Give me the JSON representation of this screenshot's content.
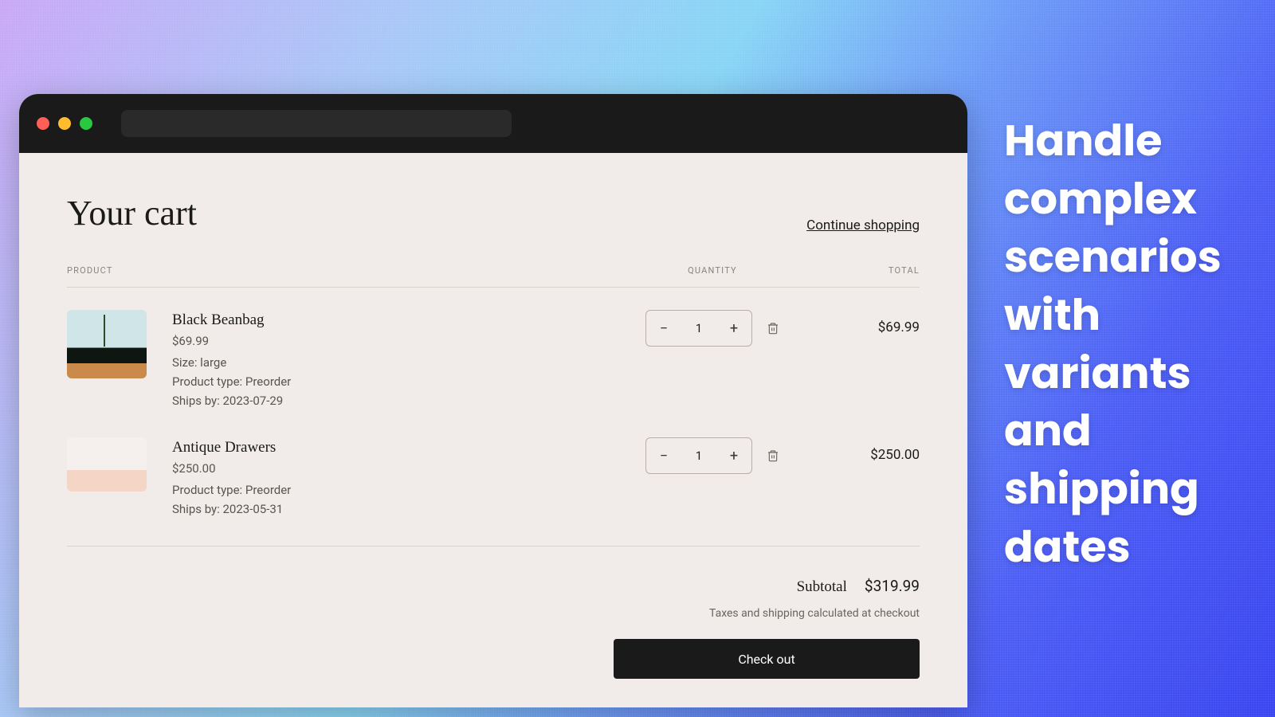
{
  "tagline": "Handle complex scenarios with variants and shipping dates",
  "page": {
    "title": "Your cart",
    "continue": "Continue shopping",
    "columns": {
      "product": "PRODUCT",
      "quantity": "QUANTITY",
      "total": "TOTAL"
    }
  },
  "items": [
    {
      "name": "Black Beanbag",
      "price": "$69.99",
      "meta": [
        "Size: large",
        "Product type: Preorder",
        "Ships by: 2023-07-29"
      ],
      "qty": "1",
      "total": "$69.99"
    },
    {
      "name": "Antique Drawers",
      "price": "$250.00",
      "meta": [
        "Product type: Preorder",
        "Ships by: 2023-05-31"
      ],
      "qty": "1",
      "total": "$250.00"
    }
  ],
  "summary": {
    "subtotal_label": "Subtotal",
    "subtotal_value": "$319.99",
    "tax_note": "Taxes and shipping calculated at checkout",
    "checkout": "Check out"
  }
}
